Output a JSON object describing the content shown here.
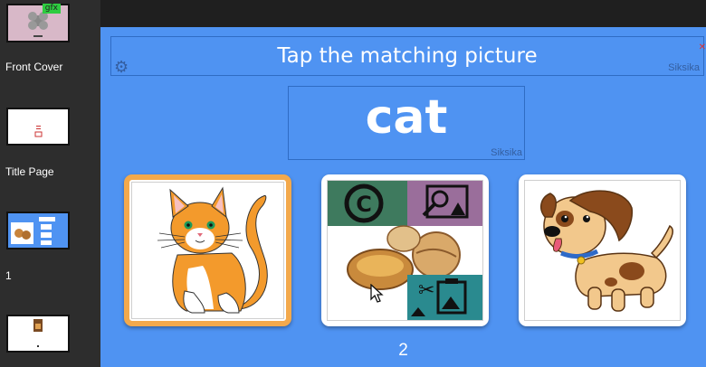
{
  "sidebar": {
    "pages": [
      {
        "label": "Front Cover",
        "badge": "gfx"
      },
      {
        "label": "Title Page"
      },
      {
        "label": "1"
      },
      {
        "label": ""
      }
    ]
  },
  "page": {
    "prompt": "Tap the matching picture",
    "prompt_language": "Siksika",
    "word": "cat",
    "word_language": "Siksika",
    "page_number": "2",
    "cards": [
      {
        "image": "cat-image",
        "selected": true
      },
      {
        "image": "placeholder-image-with-copyright-and-edit-icons",
        "selected": false
      },
      {
        "image": "dog-image",
        "selected": false
      }
    ]
  },
  "colors": {
    "page_background": "#4f93f2",
    "selected_border": "#f3a94c",
    "sidebar": "#2d2d2d"
  }
}
